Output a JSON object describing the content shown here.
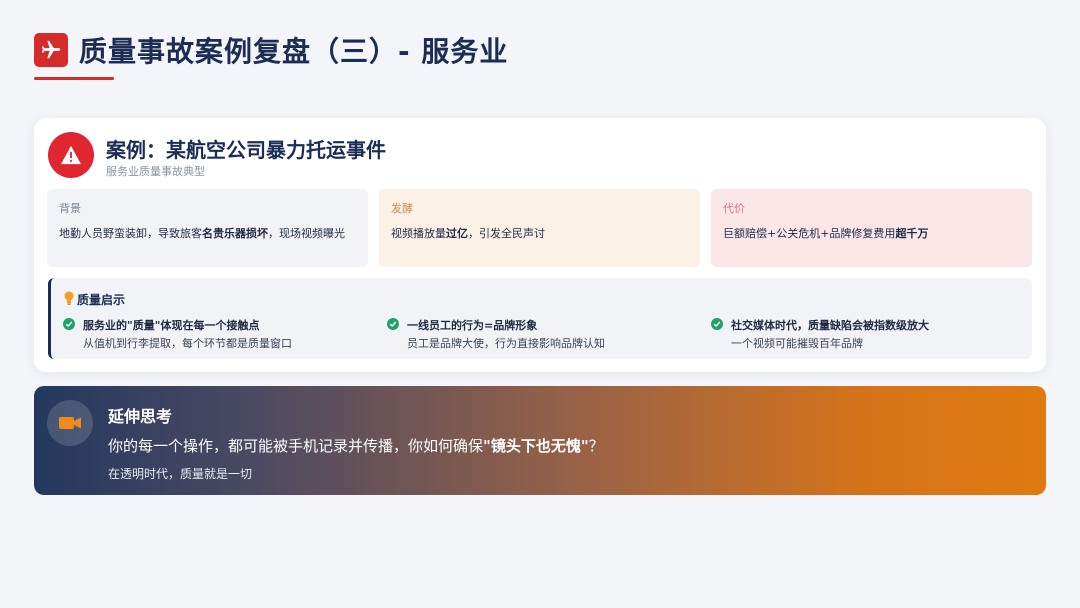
{
  "header": {
    "title": "质量事故案例复盘（三）- 服务业"
  },
  "case": {
    "title": "案例：某航空公司暴力托运事件",
    "subtitle": "服务业质量事故典型",
    "background": {
      "label": "背景",
      "text_a": "地勤人员野蛮装卸，导致旅客",
      "text_b": "名贵乐器损坏",
      "text_c": "，现场视频曝光"
    },
    "ferment": {
      "label": "发酵",
      "text_a": "视频播放量",
      "text_b": "过亿",
      "text_c": "，引发全民声讨"
    },
    "cost": {
      "label": "代价",
      "text_a": "巨额赔偿+公关危机+品牌修复费用",
      "text_b": "超千万"
    }
  },
  "insight": {
    "title": "质量启示",
    "items": [
      {
        "title": "服务业的\"质量\"体现在每一个接触点",
        "sub": "从值机到行李提取，每个环节都是质量窗口"
      },
      {
        "title": "一线员工的行为=品牌形象",
        "sub": "员工是品牌大使，行为直接影响品牌认知"
      },
      {
        "title": "社交媒体时代，质量缺陷会被指数级放大",
        "sub": "一个视频可能摧毁百年品牌"
      }
    ]
  },
  "think": {
    "title": "延伸思考",
    "question_a": "你的每一个操作，都可能被手机记录并传播，你如何确保",
    "question_b": "\"镜头下也无愧\"",
    "question_c": "？",
    "sub": "在透明时代，质量就是一切"
  },
  "icons": {
    "header": "airplane-icon",
    "case": "warning-icon",
    "insight": "lightbulb-icon",
    "check": "check-circle-icon",
    "think": "video-camera-icon"
  },
  "colors": {
    "accent": "#d62b2b",
    "navy": "#1c2d55",
    "orange": "#e07a10",
    "green": "#22a06b"
  }
}
